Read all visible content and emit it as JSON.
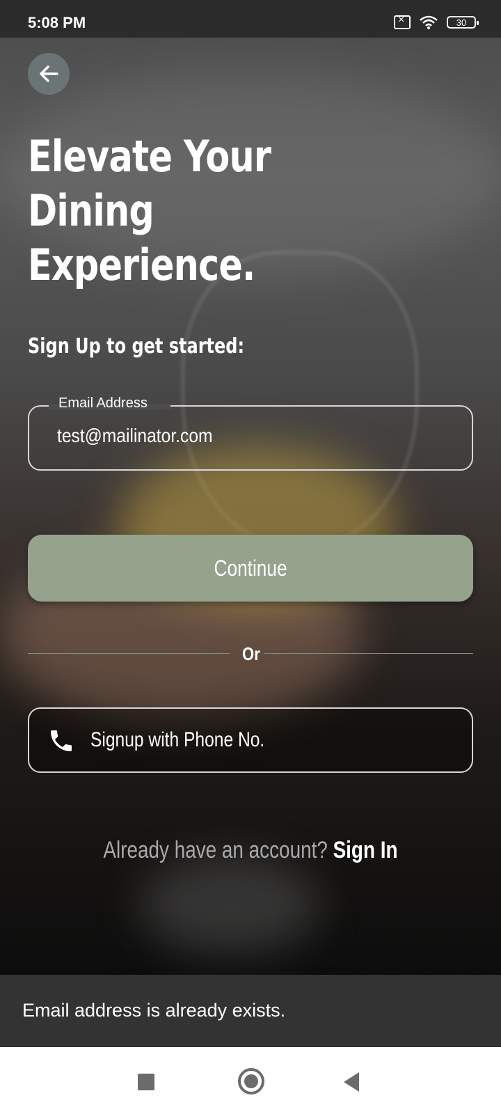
{
  "status_bar": {
    "time": "5:08 PM",
    "battery": "30"
  },
  "header": {
    "headline_line1": "Elevate Your",
    "headline_line2": "Dining Experience."
  },
  "form": {
    "subheading": "Sign Up to get started:",
    "email_label": "Email Address",
    "email_value": "test@mailinator.com",
    "continue_label": "Continue",
    "divider_label": "Or",
    "phone_button_label": "Signup with Phone No."
  },
  "footer": {
    "signin_prompt": "Already have an account?",
    "signin_link": "Sign In"
  },
  "snackbar": {
    "message": "Email address is already exists."
  },
  "colors": {
    "continue_button": "#95a38d",
    "snackbar_bg": "#333333"
  },
  "icons": [
    "back-arrow-icon",
    "phone-icon",
    "wifi-icon",
    "battery-icon",
    "no-sim-icon"
  ]
}
